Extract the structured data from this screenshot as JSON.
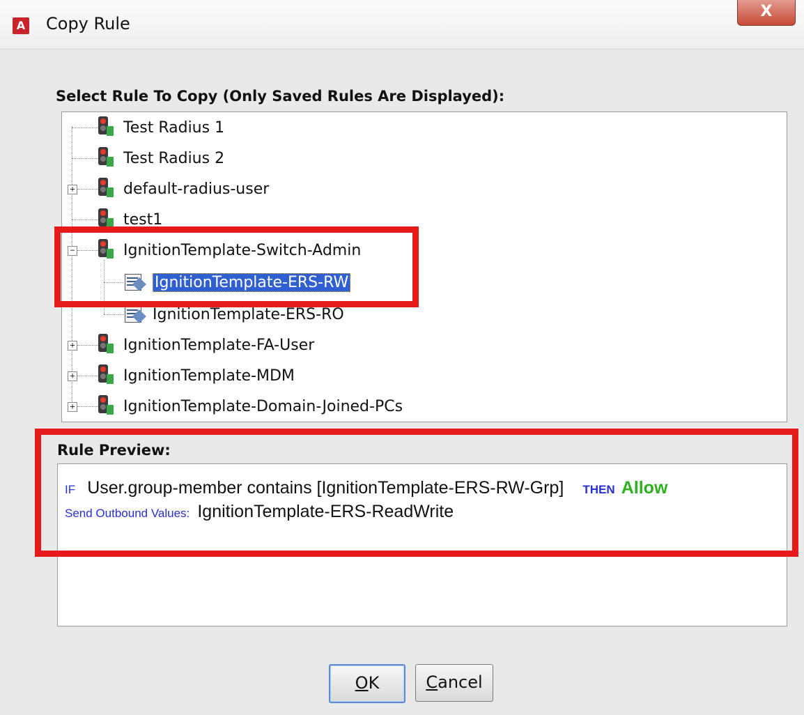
{
  "window": {
    "title": "Copy Rule",
    "app_icon_letter": "A",
    "close_label": "X"
  },
  "tree_section": {
    "label": "Select Rule To Copy (Only Saved Rules Are Displayed):",
    "items": [
      {
        "label": "Test Radius 1",
        "type": "rule",
        "expandable": false
      },
      {
        "label": "Test Radius 2",
        "type": "rule",
        "expandable": false
      },
      {
        "label": "default-radius-user",
        "type": "rule",
        "expandable": true,
        "expanded": false
      },
      {
        "label": "test1",
        "type": "rule",
        "expandable": false
      },
      {
        "label": "IgnitionTemplate-Switch-Admin",
        "type": "rule",
        "expandable": true,
        "expanded": true
      },
      {
        "label": "IgnitionTemplate-ERS-RW",
        "type": "condition",
        "selected": true
      },
      {
        "label": "IgnitionTemplate-ERS-RO",
        "type": "condition",
        "selected": false
      },
      {
        "label": "IgnitionTemplate-FA-User",
        "type": "rule",
        "expandable": true,
        "expanded": false
      },
      {
        "label": "IgnitionTemplate-MDM",
        "type": "rule",
        "expandable": true,
        "expanded": false
      },
      {
        "label": "IgnitionTemplate-Domain-Joined-PCs",
        "type": "rule",
        "expandable": true,
        "expanded": false
      }
    ]
  },
  "preview_section": {
    "label": "Rule Preview:",
    "if_keyword": "IF",
    "condition": "User.group-member contains [IgnitionTemplate-ERS-RW-Grp]",
    "then_keyword": "THEN",
    "action": "Allow",
    "outbound_label": "Send Outbound Values:",
    "outbound_value": "IgnitionTemplate-ERS-ReadWrite"
  },
  "buttons": {
    "ok": "OK",
    "cancel": "Cancel"
  },
  "colors": {
    "highlight": "#e51b1b",
    "selection": "#2f5fd0",
    "keyword": "#2830d6",
    "allow": "#2fb020"
  }
}
